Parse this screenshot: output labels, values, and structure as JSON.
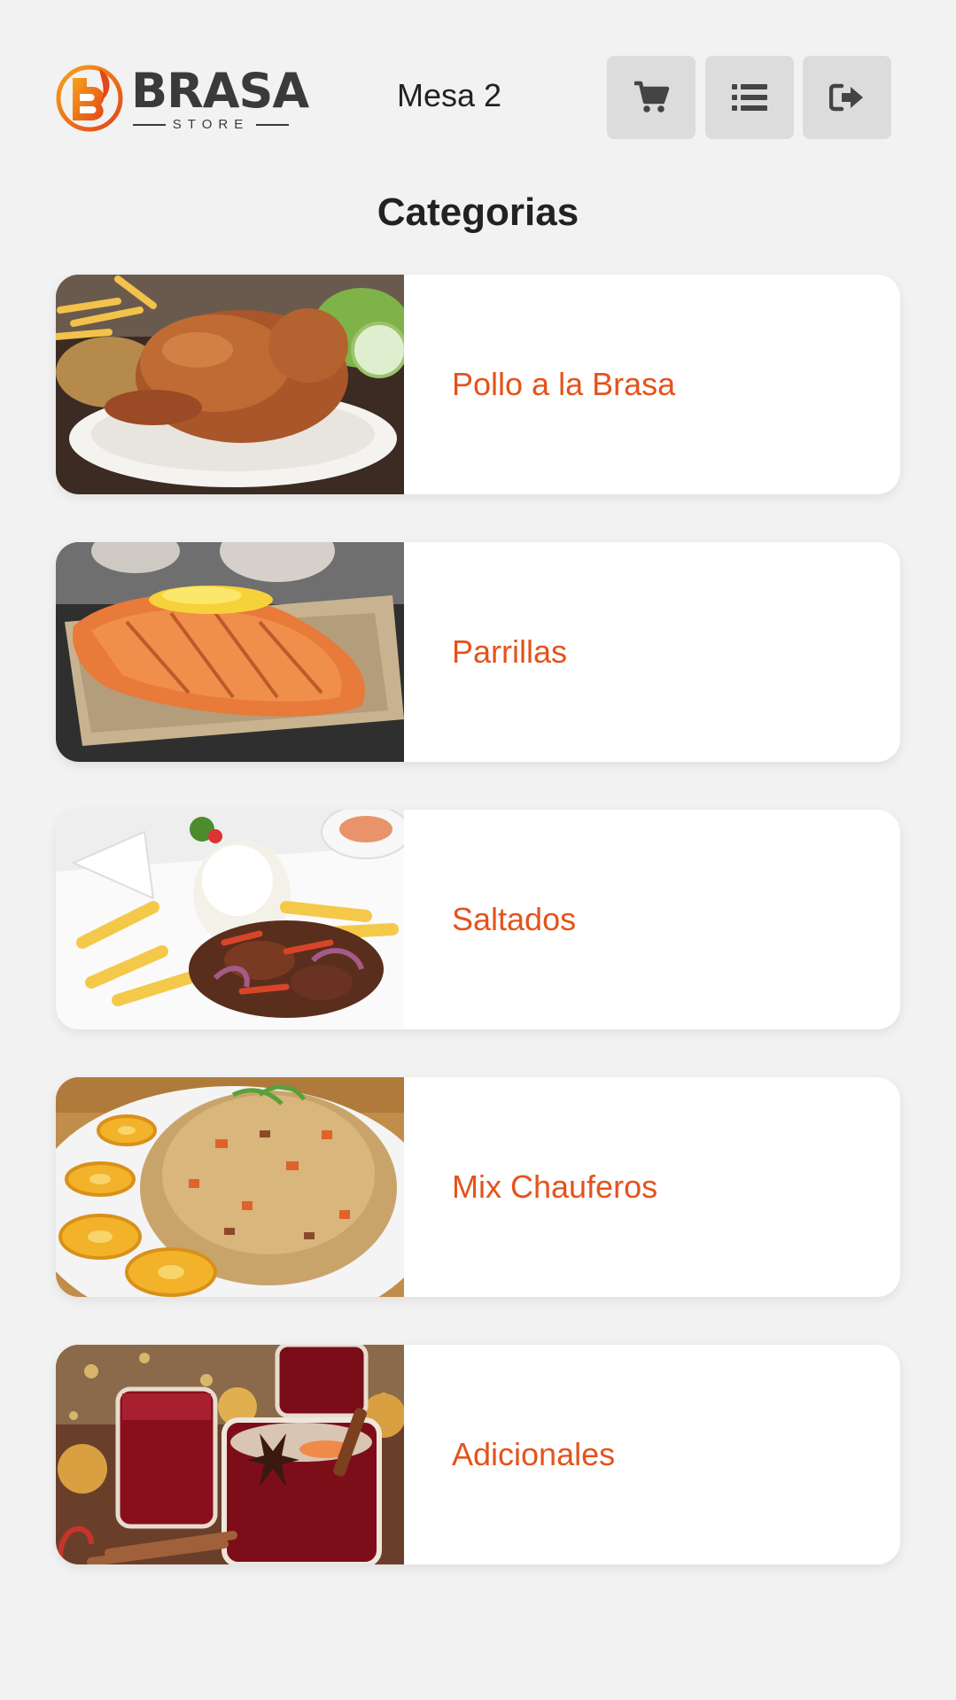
{
  "header": {
    "logo": {
      "letter": "B",
      "word": "BRASA",
      "sub": "STORE"
    },
    "table_label": "Mesa 2",
    "buttons": [
      {
        "name": "cart",
        "icon": "shopping-cart-icon"
      },
      {
        "name": "orders",
        "icon": "list-icon"
      },
      {
        "name": "logout",
        "icon": "sign-out-icon"
      }
    ]
  },
  "page_title": "Categorias",
  "categories": [
    {
      "label": "Pollo a la Brasa",
      "image": "roast-chicken-image"
    },
    {
      "label": "Parrillas",
      "image": "grilled-salmon-image"
    },
    {
      "label": "Saltados",
      "image": "lomo-saltado-image"
    },
    {
      "label": "Mix Chauferos",
      "image": "fried-rice-image"
    },
    {
      "label": "Adicionales",
      "image": "mulled-wine-drinks-image"
    }
  ],
  "colors": {
    "accent": "#e4531b",
    "background": "#f2f2f2",
    "button_bg": "#dcdcdc",
    "icon": "#444444"
  }
}
